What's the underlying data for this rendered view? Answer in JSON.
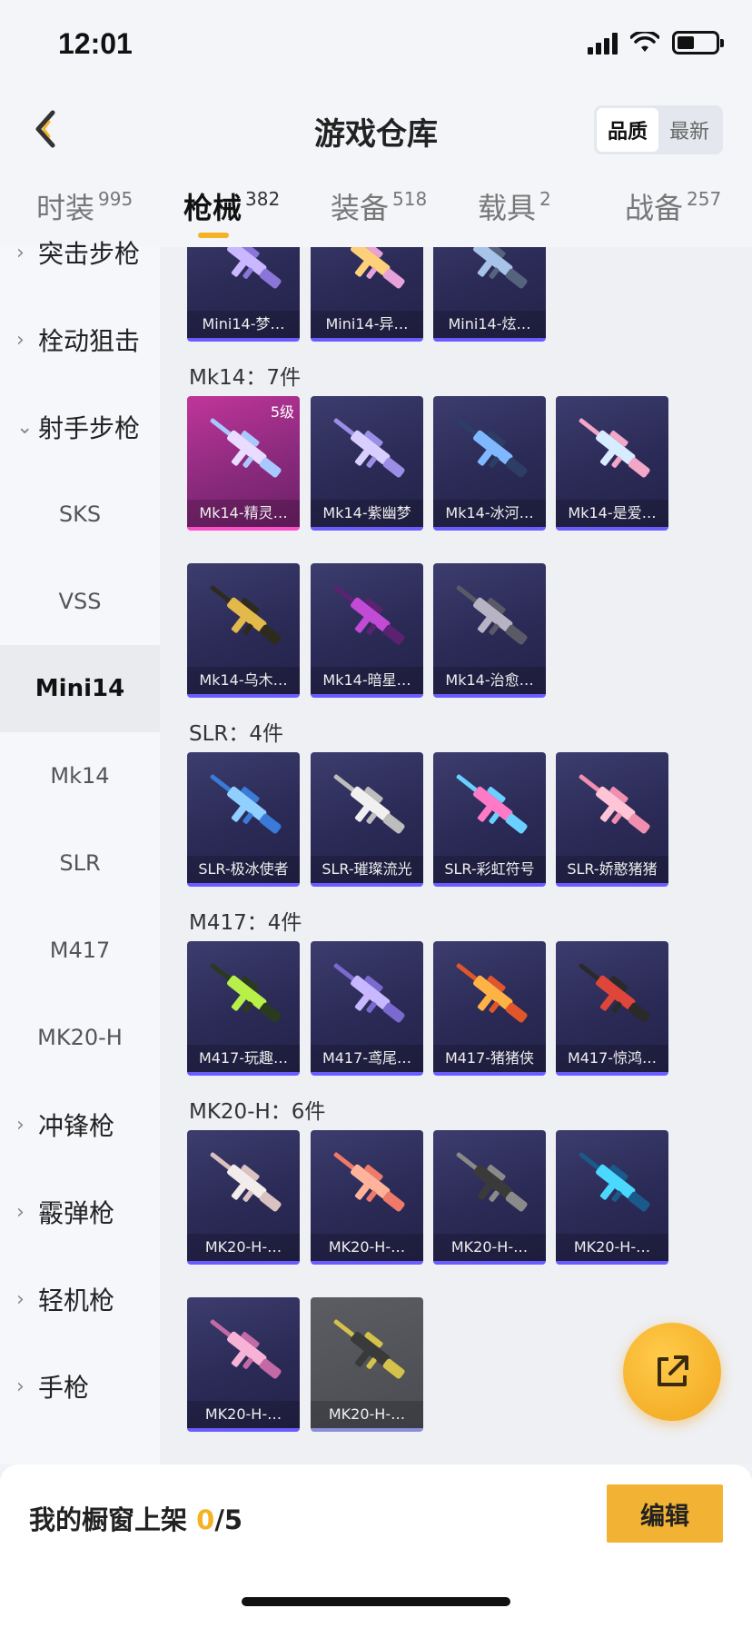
{
  "status": {
    "time": "12:01"
  },
  "header": {
    "title": "游戏仓库",
    "sort_options": [
      "品质",
      "最新"
    ],
    "active_sort": "品质"
  },
  "tabs": [
    {
      "label": "时装",
      "count": "995"
    },
    {
      "label": "枪械",
      "count": "382"
    },
    {
      "label": "装备",
      "count": "518"
    },
    {
      "label": "载具",
      "count": "2"
    },
    {
      "label": "战备",
      "count": "257"
    }
  ],
  "active_tab": "枪械",
  "sidebar": [
    {
      "label": "突击步枪",
      "type": "category",
      "expanded": false
    },
    {
      "label": "栓动狙击",
      "type": "category",
      "expanded": false
    },
    {
      "label": "射手步枪",
      "type": "category",
      "expanded": true
    },
    {
      "label": "SKS",
      "type": "sub"
    },
    {
      "label": "VSS",
      "type": "sub"
    },
    {
      "label": "Mini14",
      "type": "sub",
      "active": true
    },
    {
      "label": "Mk14",
      "type": "sub"
    },
    {
      "label": "SLR",
      "type": "sub"
    },
    {
      "label": "M417",
      "type": "sub"
    },
    {
      "label": "MK20-H",
      "type": "sub"
    },
    {
      "label": "冲锋枪",
      "type": "category",
      "expanded": false
    },
    {
      "label": "霰弹枪",
      "type": "category",
      "expanded": false
    },
    {
      "label": "轻机枪",
      "type": "category",
      "expanded": false
    },
    {
      "label": "手枪",
      "type": "category",
      "expanded": false
    }
  ],
  "sections": [
    {
      "title": "",
      "items": [
        {
          "name": "Mini14-梦…",
          "colors": [
            "#c9b8ff",
            "#8a76d8"
          ]
        },
        {
          "name": "Mini14-异…",
          "colors": [
            "#ffd07a",
            "#e7a3d9"
          ]
        },
        {
          "name": "Mini14-炫…",
          "colors": [
            "#a7c4e8",
            "#55647c"
          ]
        }
      ]
    },
    {
      "title": "Mk14：7件",
      "items": [
        {
          "name": "Mk14-精灵…",
          "level": "5级",
          "rarity": "pink",
          "colors": [
            "#e9dcff",
            "#a9c8ff"
          ]
        },
        {
          "name": "Mk14-紫幽梦",
          "colors": [
            "#d8cfff",
            "#9b8ee6"
          ]
        },
        {
          "name": "Mk14-冰河…",
          "colors": [
            "#7fb8ff",
            "#2c3e66"
          ]
        },
        {
          "name": "Mk14-是爱…",
          "colors": [
            "#d8ecff",
            "#f2a6c8"
          ]
        },
        {
          "name": "Mk14-乌木…",
          "colors": [
            "#e2b94a",
            "#2e2a1e"
          ]
        },
        {
          "name": "Mk14-暗星…",
          "colors": [
            "#c24bd6",
            "#5a2270"
          ]
        },
        {
          "name": "Mk14-治愈…",
          "colors": [
            "#b8b3c4",
            "#5a5a66"
          ]
        }
      ]
    },
    {
      "title": "SLR：4件",
      "items": [
        {
          "name": "SLR-极冰使者",
          "colors": [
            "#8fd0ff",
            "#3a7ad8"
          ]
        },
        {
          "name": "SLR-璀璨流光",
          "colors": [
            "#f0f0f0",
            "#bdbdbd"
          ]
        },
        {
          "name": "SLR-彩虹符号",
          "colors": [
            "#ff7ac6",
            "#6ad0ff"
          ]
        },
        {
          "name": "SLR-娇憨猪猪",
          "colors": [
            "#ffc4d6",
            "#f08fb0"
          ]
        }
      ]
    },
    {
      "title": "M417：4件",
      "items": [
        {
          "name": "M417-玩趣…",
          "colors": [
            "#b8f04a",
            "#2a3a20"
          ]
        },
        {
          "name": "M417-鸢尾…",
          "colors": [
            "#c8b8ff",
            "#7a6ad0"
          ]
        },
        {
          "name": "M417-猪猪侠",
          "colors": [
            "#ffb347",
            "#e0562a"
          ]
        },
        {
          "name": "M417-惊鸿…",
          "colors": [
            "#e0453a",
            "#2a2a2a"
          ]
        }
      ]
    },
    {
      "title": "MK20-H：6件",
      "items": [
        {
          "name": "MK20-H-…",
          "colors": [
            "#f2ecea",
            "#d9c2c0"
          ]
        },
        {
          "name": "MK20-H-…",
          "colors": [
            "#ffb39a",
            "#f07a6a"
          ]
        },
        {
          "name": "MK20-H-…",
          "colors": [
            "#3a3a3a",
            "#8a8a8a"
          ]
        },
        {
          "name": "MK20-H-…",
          "colors": [
            "#4ad8ff",
            "#1a5a8a"
          ]
        },
        {
          "name": "MK20-H-…",
          "colors": [
            "#f7b3d6",
            "#c26aa6"
          ]
        },
        {
          "name": "MK20-H-…",
          "rarity": "gray",
          "colors": [
            "#3a3a3a",
            "#d4c24a"
          ]
        }
      ]
    }
  ],
  "bottom": {
    "showcase_label": "我的橱窗上架",
    "showcase_count": "0",
    "showcase_total": "/5",
    "edit_label": "编辑"
  },
  "colors": {
    "accent": "#f5b225",
    "card_bg": "#2b2a56",
    "card_border": "#6a5cff"
  }
}
